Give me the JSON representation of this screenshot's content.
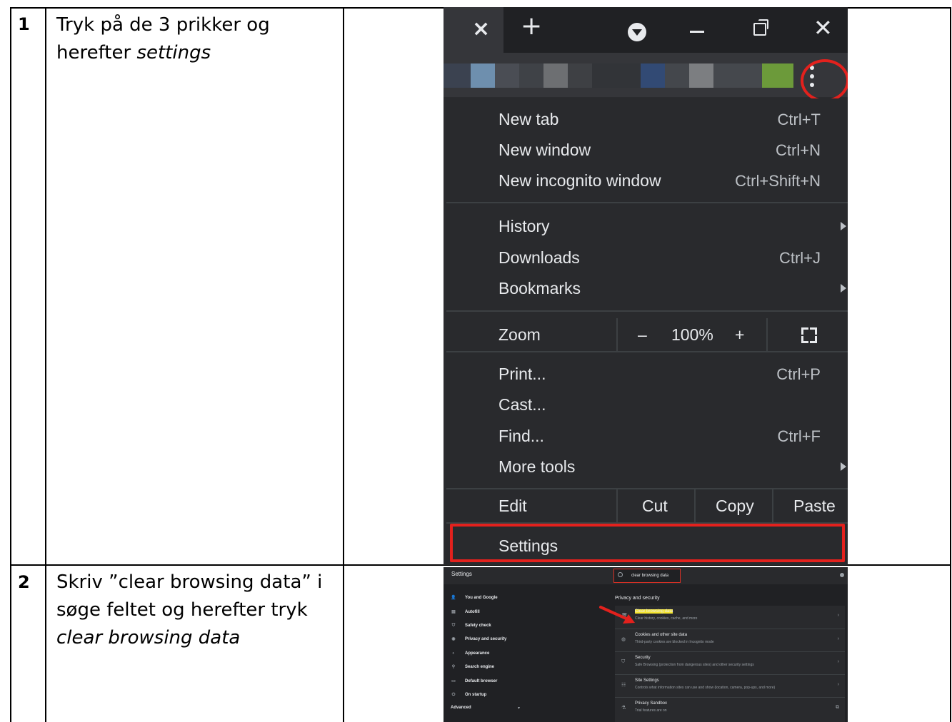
{
  "steps": [
    {
      "number": "1",
      "text_line1": "Tryk på de 3 prikker og",
      "text_line2_prefix": "herefter ",
      "text_line2_em": "settings"
    },
    {
      "number": "2",
      "text_line1": "Skriv ”clear browsing data” i",
      "text_line2": "søge feltet og herefter tryk",
      "text_line3_em": "clear browsing data"
    }
  ],
  "chrome_menu": {
    "titlebar": {
      "close_tab": "×",
      "new_tab": "+",
      "close_window": "✕"
    },
    "items": {
      "new_tab": {
        "label": "New tab",
        "shortcut": "Ctrl+T"
      },
      "new_window": {
        "label": "New window",
        "shortcut": "Ctrl+N"
      },
      "new_incognito": {
        "label": "New incognito window",
        "shortcut": "Ctrl+Shift+N"
      },
      "history": {
        "label": "History"
      },
      "downloads": {
        "label": "Downloads",
        "shortcut": "Ctrl+J"
      },
      "bookmarks": {
        "label": "Bookmarks"
      },
      "print": {
        "label": "Print...",
        "shortcut": "Ctrl+P"
      },
      "cast": {
        "label": "Cast..."
      },
      "find": {
        "label": "Find...",
        "shortcut": "Ctrl+F"
      },
      "more_tools": {
        "label": "More tools"
      },
      "settings": {
        "label": "Settings"
      }
    },
    "zoom": {
      "label": "Zoom",
      "minus": "–",
      "value": "100%",
      "plus": "+"
    },
    "edit": {
      "label": "Edit",
      "cut": "Cut",
      "copy": "Copy",
      "paste": "Paste"
    },
    "colors": {
      "highlight": "#e3211d",
      "menu_bg": "#292a2d",
      "text": "#e8eaed"
    }
  },
  "settings_page": {
    "title": "Settings",
    "search_value": "clear browsing data",
    "nav": [
      {
        "icon": "👤",
        "label": "You and Google"
      },
      {
        "icon": "▤",
        "label": "Autofill"
      },
      {
        "icon": "⛉",
        "label": "Safety check"
      },
      {
        "icon": "◉",
        "label": "Privacy and security"
      },
      {
        "icon": "◐",
        "label": "Appearance"
      },
      {
        "icon": "⚲",
        "label": "Search engine"
      },
      {
        "icon": "▭",
        "label": "Default browser"
      },
      {
        "icon": "⏻",
        "label": "On startup"
      }
    ],
    "advanced": "Advanced",
    "section_title": "Privacy and security",
    "rows": [
      {
        "icon": "🗑",
        "title": "Clear browsing data",
        "desc": "Clear history, cookies, cache, and more"
      },
      {
        "icon": "◍",
        "title": "Cookies and other site data",
        "desc": "Third-party cookies are blocked in Incognito mode"
      },
      {
        "icon": "⛉",
        "title": "Security",
        "desc": "Safe Browsing (protection from dangerous sites) and other security settings"
      },
      {
        "icon": "☷",
        "title": "Site Settings",
        "desc": "Controls what information sites can use and show (location, camera, pop-ups, and more)"
      },
      {
        "icon": "⚗",
        "title": "Privacy Sandbox",
        "desc": "Trial features are on"
      }
    ]
  }
}
